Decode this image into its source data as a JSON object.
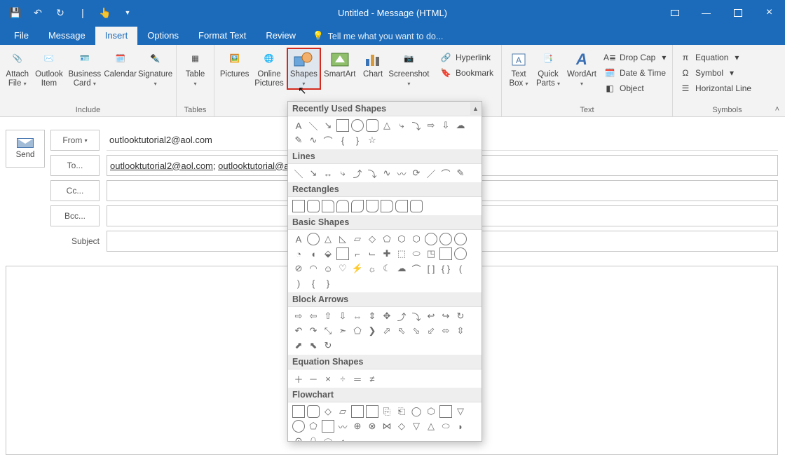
{
  "titlebar": {
    "title": "Untitled - Message (HTML)"
  },
  "tabs": {
    "file": "File",
    "message": "Message",
    "insert": "Insert",
    "options": "Options",
    "format": "Format Text",
    "review": "Review",
    "tellme": "Tell me what you want to do..."
  },
  "ribbon": {
    "include": {
      "label": "Include",
      "attach": "Attach File",
      "item": "Outlook Item",
      "card": "Business Card",
      "calendar": "Calendar",
      "signature": "Signature"
    },
    "tables": {
      "label": "Tables",
      "table": "Table"
    },
    "illus": {
      "pictures": "Pictures",
      "online": "Online Pictures",
      "shapes": "Shapes",
      "smartart": "SmartArt",
      "chart": "Chart",
      "screenshot": "Screenshot"
    },
    "links": {
      "hyperlink": "Hyperlink",
      "bookmark": "Bookmark"
    },
    "text": {
      "label": "Text",
      "box": "Text Box",
      "quick": "Quick Parts",
      "wordart": "WordArt",
      "dropcap": "Drop Cap",
      "datetime": "Date & Time",
      "object": "Object"
    },
    "symbols": {
      "label": "Symbols",
      "equation": "Equation",
      "symbol": "Symbol",
      "hline": "Horizontal Line"
    }
  },
  "compose": {
    "send": "Send",
    "from_label": "From",
    "from_value": "outlooktutorial2@aol.com",
    "to_label": "To...",
    "to_value_a": "outlooktutorial2@aol.com",
    "to_value_b": "outlooktutorial@aol.c",
    "cc_label": "Cc...",
    "bcc_label": "Bcc...",
    "subject_label": "Subject"
  },
  "shapes_menu": {
    "recent": "Recently Used Shapes",
    "lines": "Lines",
    "rects": "Rectangles",
    "basic": "Basic Shapes",
    "arrows": "Block Arrows",
    "equation": "Equation Shapes",
    "flowchart": "Flowchart"
  }
}
